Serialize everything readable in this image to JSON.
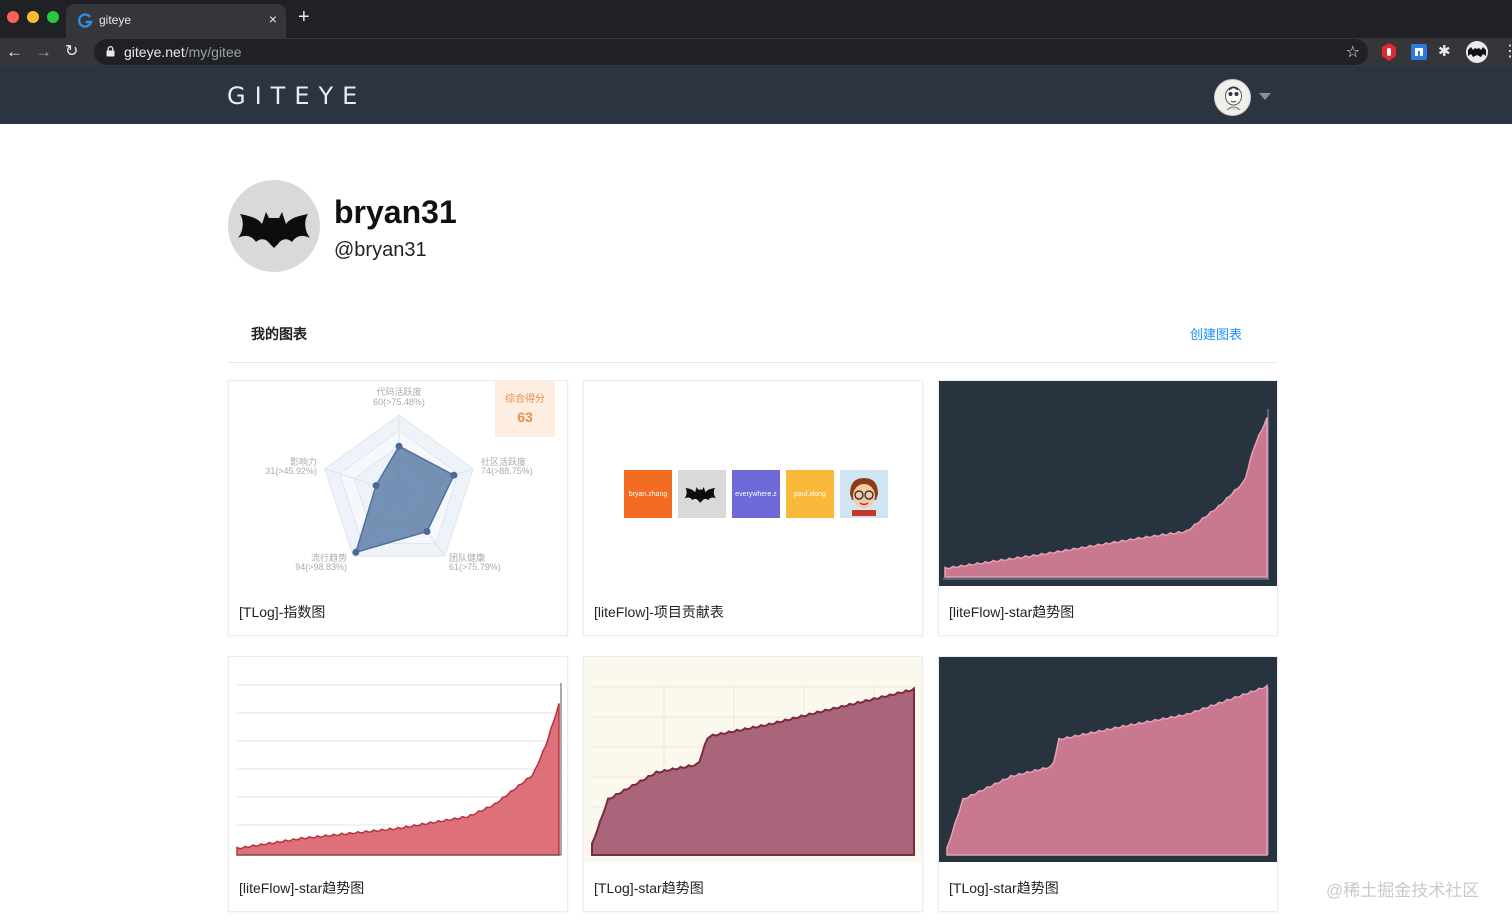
{
  "browser": {
    "tab_title": "giteye",
    "url_host": "giteye.net",
    "url_path": "/my/gitee",
    "new_tab": "+",
    "close": "×",
    "back": "←",
    "forward": "→",
    "reload": "↻",
    "star": "☆",
    "puzzle": "✱",
    "menu": "⋮"
  },
  "header": {
    "logo": "GITEYE"
  },
  "profile": {
    "name": "bryan31",
    "handle": "@bryan31"
  },
  "section": {
    "title": "我的图表",
    "create_label": "创建图表"
  },
  "radar": {
    "score_label": "综合得分",
    "score_value": "63",
    "axes": [
      {
        "name": "代码活跃度",
        "value": "60(>75.48%)",
        "level": 0.6
      },
      {
        "name": "社区活跃度",
        "value": "74(>88.75%)",
        "level": 0.74
      },
      {
        "name": "团队健康",
        "value": "61(>75.79%)",
        "level": 0.61
      },
      {
        "name": "流行趋势",
        "value": "94(>98.83%)",
        "level": 0.94
      },
      {
        "name": "影响力",
        "value": "31(>45.92%)",
        "level": 0.31
      }
    ]
  },
  "contributors": [
    {
      "name": "bryan.zhang",
      "color": "#f26c22",
      "kind": "text"
    },
    {
      "name": "",
      "color": "#d9d9d9",
      "kind": "bat"
    },
    {
      "name": "everywhere.z",
      "color": "#6e6ad8",
      "kind": "text"
    },
    {
      "name": "paul.xiong",
      "color": "#f8b93a",
      "kind": "text"
    },
    {
      "name": "",
      "color": "#cfe6f2",
      "kind": "face"
    }
  ],
  "cards": [
    {
      "title": "[TLog]-指数图"
    },
    {
      "title": "[liteFlow]-项目贡献表"
    },
    {
      "title": "[liteFlow]-star趋势图"
    },
    {
      "title": "[liteFlow]-star趋势图"
    },
    {
      "title": "[TLog]-star趋势图"
    },
    {
      "title": "[TLog]-star趋势图"
    }
  ],
  "colors": {
    "accent": "#1890ff",
    "header_bg": "#2d3441",
    "dark_chart_bg": "#283340",
    "pink_fill": "#c9798f",
    "red_fill": "#d9606a",
    "maroon_fill": "#a9667a"
  },
  "watermark": "@稀土掘金技术社区"
}
